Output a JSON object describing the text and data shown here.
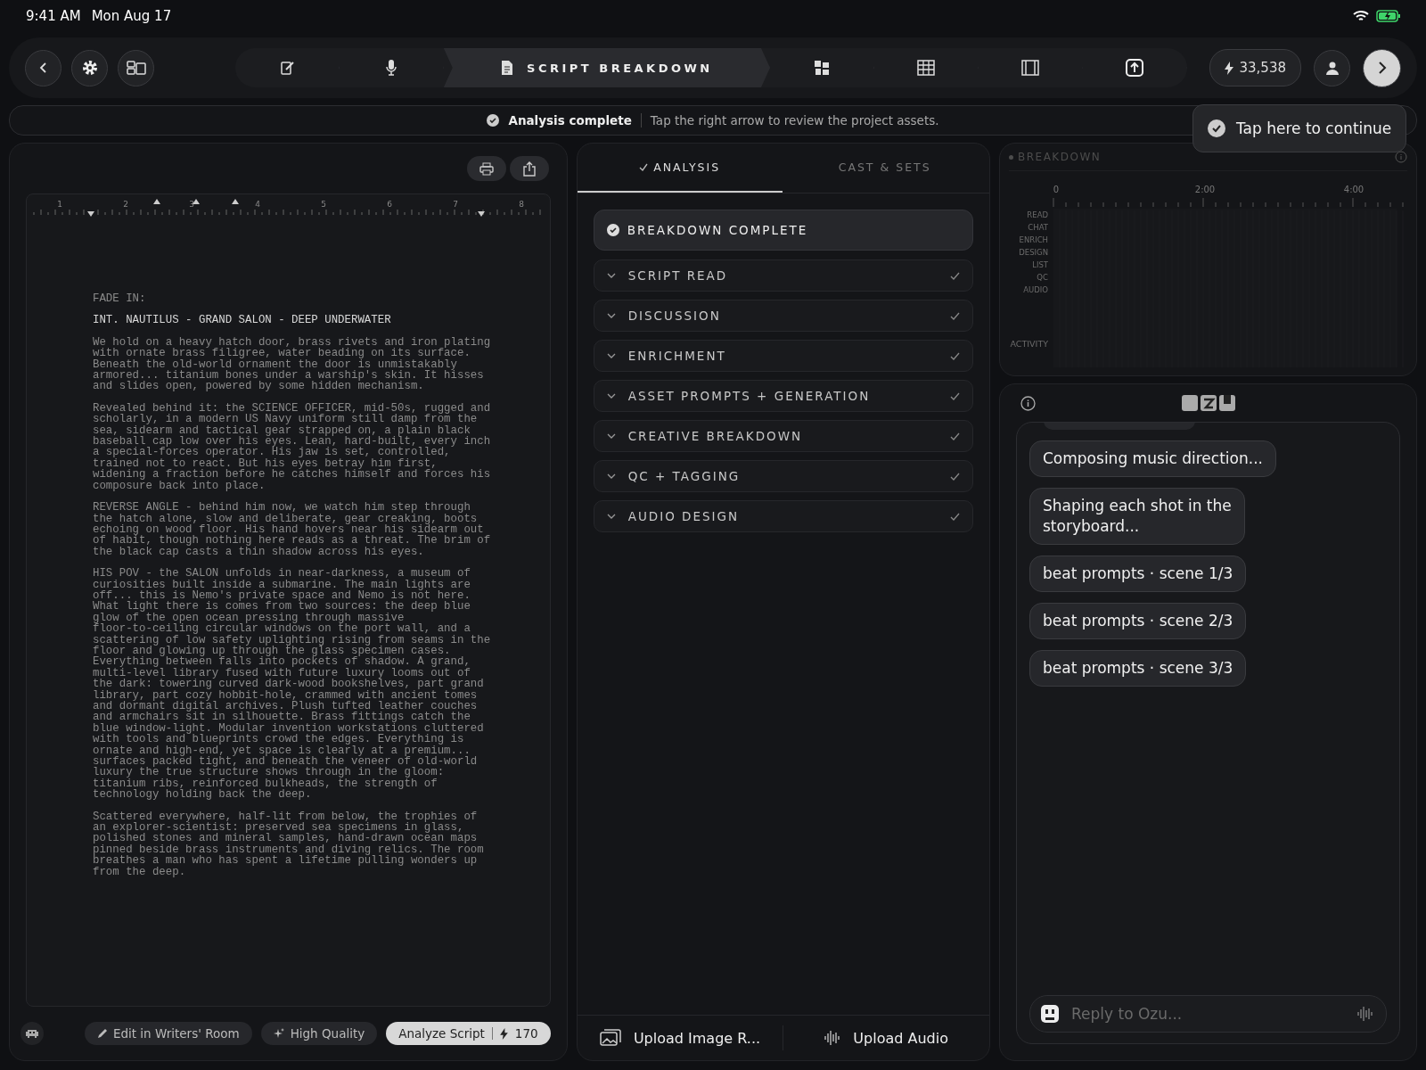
{
  "status_bar": {
    "time": "9:41 AM",
    "date": "Mon Aug 17"
  },
  "nav": {
    "steps": [
      {
        "selected": false
      },
      {
        "selected": false
      },
      {
        "selected": true,
        "label": "SCRIPT BREAKDOWN"
      },
      {
        "selected": false
      },
      {
        "selected": false
      },
      {
        "selected": false
      },
      {
        "selected": false
      }
    ],
    "credits": "33,538"
  },
  "banner": {
    "title": "Analysis complete",
    "message": "Tap the right arrow to review the project assets."
  },
  "tooltip": "Tap here to continue",
  "script": {
    "ruler": [
      "1",
      "2",
      "3",
      "4",
      "5",
      "6",
      "7",
      "8"
    ],
    "transition": "FADE IN:",
    "heading": "INT. NAUTILUS - GRAND SALON - DEEP UNDERWATER",
    "paragraphs": [
      "We hold on a heavy hatch door, brass rivets and iron plating\nwith ornate brass filigree, water beading on its surface.\nBeneath the old-world ornament the door is unmistakably\narmored... titanium bones under a warship's skin. It hisses\nand slides open, powered by some hidden mechanism.",
      "Revealed behind it: the SCIENCE OFFICER, mid-50s, rugged and\nscholarly, in a modern US Navy uniform still damp from the\nsea, sidearm and tactical gear strapped on, a plain black\nbaseball cap low over his eyes. Lean, hard-built, every inch\na special-forces operator. His jaw is set, controlled,\ntrained not to react. But his eyes betray him first,\nwidening a fraction before he catches himself and forces his\ncomposure back into place.",
      "REVERSE ANGLE - behind him now, we watch him step through\nthe hatch alone, slow and deliberate, gear creaking, boots\nechoing on wood floor. His hand hovers near his sidearm out\nof habit, though nothing here reads as a threat. The brim of\nthe black cap casts a thin shadow across his eyes.",
      "HIS POV - the SALON unfolds in near-darkness, a museum of\ncuriosities built inside a submarine. The main lights are\noff... this is Nemo's private space and Nemo is not here.\nWhat light there is comes from two sources: the deep blue\nglow of the open ocean pressing through massive\nfloor-to-ceiling circular windows on the port wall, and a\nscattering of low safety uplighting rising from seams in the\nfloor and glowing up through the glass specimen cases.\nEverything between falls into pockets of shadow. A grand,\nmulti-level library fused with future luxury looms out of\nthe dark: towering curved dark-wood bookshelves, part grand\nlibrary, part cozy hobbit-hole, crammed with ancient tomes\nand dormant digital archives. Plush tufted leather couches\nand armchairs sit in silhouette. Brass fittings catch the\nblue window-light. Modular invention workstations cluttered\nwith tools and blueprints crowd the edges. Everything is\nornate and high-end, yet space is clearly at a premium...\nsurfaces packed tight, and beneath the veneer of old-world\nluxury the true structure shows through in the gloom:\ntitanium ribs, reinforced bulkheads, the strength of\ntechnology holding back the deep.",
      "Scattered everywhere, half-lit from below, the trophies of\nan explorer-scientist: preserved sea specimens in glass,\npolished stones and mineral samples, hand-drawn ocean maps\npinned beside brass instruments and diving relics. The room\nbreathes a man who has spent a lifetime pulling wonders up\nfrom the deep."
    ]
  },
  "script_actions": {
    "edit": "Edit in Writers' Room",
    "quality": "High Quality",
    "analyze": "Analyze Script",
    "cost": "170"
  },
  "analysis": {
    "tabs": [
      {
        "label": "ANALYSIS",
        "selected": true
      },
      {
        "label": "CAST & SETS",
        "selected": false
      }
    ],
    "status": "BREAKDOWN COMPLETE",
    "sections": [
      {
        "label": "SCRIPT READ",
        "expanded": false,
        "done": true
      },
      {
        "label": "DISCUSSION",
        "expanded": false,
        "done": true
      },
      {
        "label": "ENRICHMENT",
        "expanded": false,
        "done": true
      },
      {
        "label": "ASSET PROMPTS + GENERATION",
        "expanded": false,
        "done": true
      },
      {
        "label": "CREATIVE BREAKDOWN",
        "expanded": false,
        "done": true
      },
      {
        "label": "QC + TAGGING",
        "expanded": false,
        "done": true
      },
      {
        "label": "AUDIO DESIGN",
        "expanded": false,
        "done": true
      }
    ],
    "uploads": [
      "Upload Image R...",
      "Upload Audio"
    ]
  },
  "breakdown": {
    "title": "BREAKDOWN",
    "ticks": [
      "0",
      "2:00",
      "4:00"
    ],
    "lanes": [
      "READ",
      "CHAT",
      "ENRICH",
      "DESIGN",
      "LIST",
      "QC",
      "AUDIO"
    ],
    "activity": "ACTIVITY"
  },
  "chat": {
    "messages": [
      "Composing music direction...",
      "Shaping each shot in the\nstoryboard...",
      "beat prompts · scene 1/3",
      "beat prompts · scene 2/3",
      "beat prompts · scene 3/3"
    ],
    "placeholder": "Reply to Ozu..."
  }
}
